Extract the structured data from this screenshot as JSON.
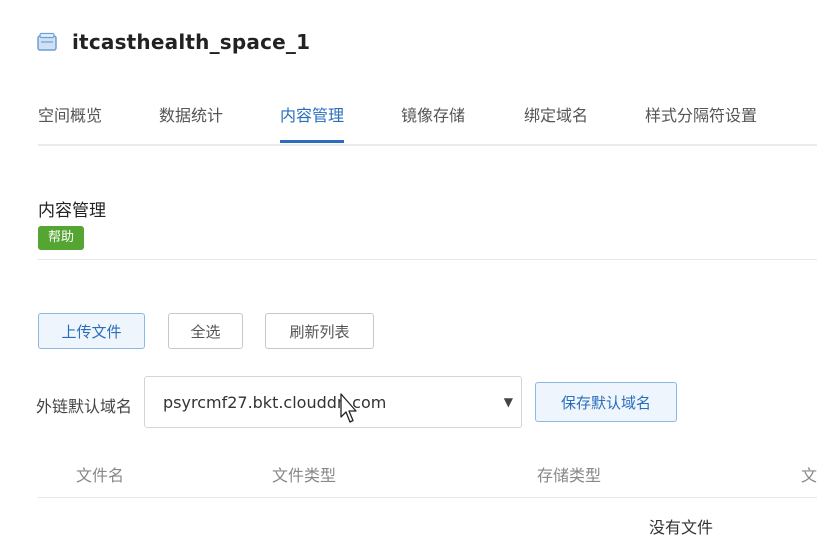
{
  "header": {
    "title": "itcasthealth_space_1",
    "icon": "bucket-icon"
  },
  "tabs": [
    {
      "label": "空间概览",
      "active": false
    },
    {
      "label": "数据统计",
      "active": false
    },
    {
      "label": "内容管理",
      "active": true
    },
    {
      "label": "镜像存储",
      "active": false
    },
    {
      "label": "绑定域名",
      "active": false
    },
    {
      "label": "样式分隔符设置",
      "active": false
    }
  ],
  "section": {
    "title": "内容管理",
    "help_label": "帮助"
  },
  "toolbar": {
    "upload_label": "上传文件",
    "select_all_label": "全选",
    "refresh_label": "刷新列表"
  },
  "domain": {
    "label": "外链默认域名",
    "selected": "psyrcmf27.bkt.clouddn.com",
    "save_label": "保存默认域名"
  },
  "table": {
    "columns": [
      "文件名",
      "文件类型",
      "存储类型",
      "文"
    ],
    "empty_text": "没有文件"
  },
  "colors": {
    "accent": "#2a6ebb",
    "help_badge": "#55a532"
  }
}
